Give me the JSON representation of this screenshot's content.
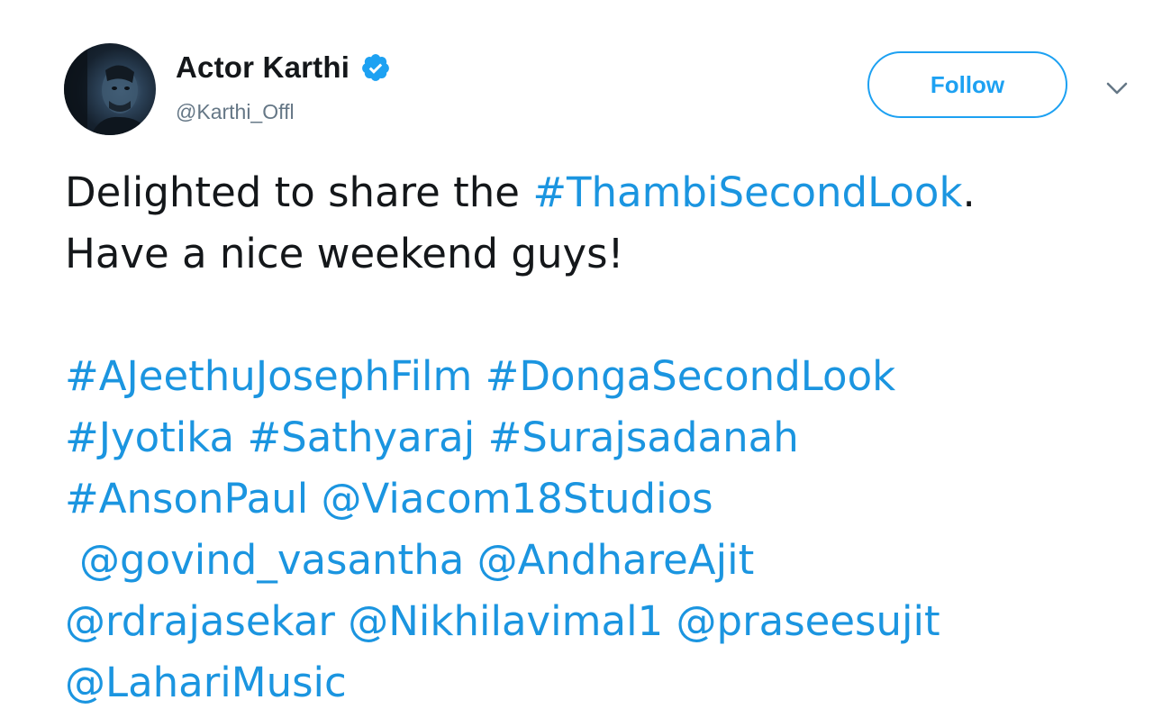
{
  "author": {
    "display_name": "Actor Karthi",
    "handle": "@Karthi_Offl",
    "verified": true
  },
  "follow_button": {
    "label": "Follow"
  },
  "tweet": {
    "line1": {
      "text_before": "Delighted to share the ",
      "hashtag": "#ThambiSecondLook",
      "text_after": "."
    },
    "line2": {
      "text": "Have a nice weekend guys!"
    },
    "tags": {
      "ajeethujosephfilm": "#AJeethuJosephFilm",
      "dongasecondlook": "#DongaSecondLook",
      "jyotika": "#Jyotika",
      "sathyaraj": "#Sathyaraj",
      "surajsadanah": "#Surajsadanah",
      "ansonpaul": "#AnsonPaul",
      "viacom18studios": "@Viacom18Studios",
      "govind_vasantha": "@govind_vasantha",
      "andhareajit": "@AndhareAjit",
      "rdrajasekar": "@rdrajasekar",
      "nikhilavimal1": "@Nikhilavimal1",
      "praseesujit": "@praseesujit",
      "laharimusic": "@LahariMusic"
    }
  },
  "colors": {
    "link": "#1b95e0",
    "text": "#14171a",
    "secondary": "#657786",
    "follow_accent": "#1da1f2"
  },
  "icons": {
    "verified": "verified-badge-icon",
    "caret": "chevron-down-icon"
  }
}
